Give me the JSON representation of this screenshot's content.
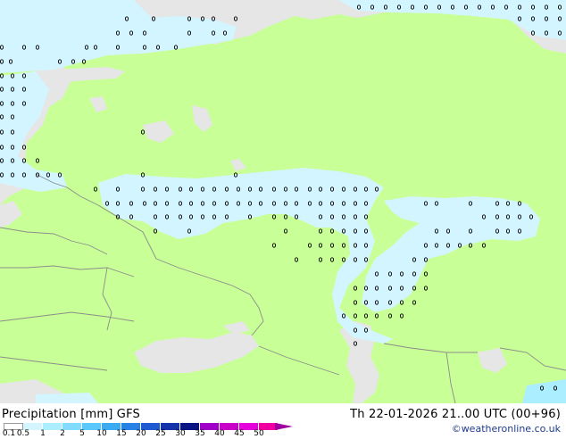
{
  "map": {
    "colors": {
      "land": "#c8ff96",
      "sea": "#e6e6e6",
      "precip_light": "#d2f5ff",
      "precip_mid": "#aaeeff",
      "border": "#8c8c8c",
      "marker": "#000000"
    },
    "precip_dot_icon": "dot-marker"
  },
  "legend": {
    "title": "Precipitation [mm]  GFS",
    "valid": "Th 22-01-2026 21..00 UTC (00+96)",
    "credit": "©weatheronline.co.uk",
    "scale": [
      {
        "label": "0.1",
        "color": "#ffffff"
      },
      {
        "label": "0.5",
        "color": "#d2f5ff"
      },
      {
        "label": "1",
        "color": "#aaeeff"
      },
      {
        "label": "2",
        "color": "#82dcff"
      },
      {
        "label": "5",
        "color": "#5ac8ff"
      },
      {
        "label": "10",
        "color": "#3caaf0"
      },
      {
        "label": "15",
        "color": "#2882e6"
      },
      {
        "label": "20",
        "color": "#1e5ad2"
      },
      {
        "label": "25",
        "color": "#1432aa"
      },
      {
        "label": "30",
        "color": "#0a1482"
      },
      {
        "label": "35",
        "color": "#a000c8"
      },
      {
        "label": "40",
        "color": "#c800c8"
      },
      {
        "label": "45",
        "color": "#e600dc"
      },
      {
        "label": "50",
        "color": "#f000a0"
      }
    ]
  }
}
